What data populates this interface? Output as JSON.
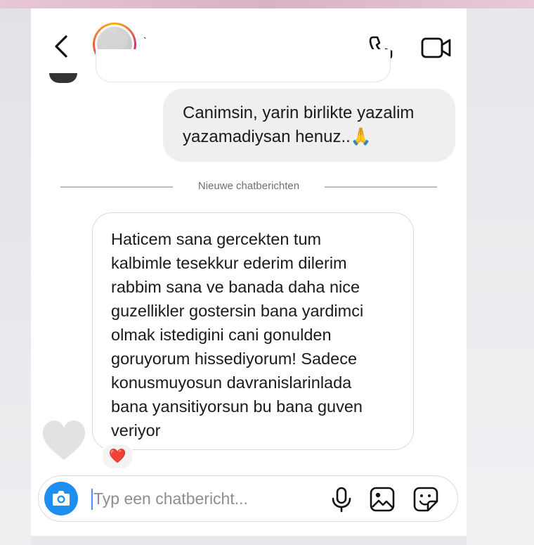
{
  "header": {
    "back_icon": "chevron-left-icon",
    "contact_name": "`",
    "call_icon": "phone-icon",
    "video_icon": "video-camera-icon"
  },
  "thread": {
    "outgoing": {
      "lines": [
        "Canimsin, yarin birlikte yazalim",
        "yazamadiysan henuz..🙏"
      ]
    },
    "divider_label": "Nieuwe chatberichten",
    "incoming": {
      "lines": [
        "Haticem sana gercekten tum",
        "kalbimle tesekkur ederim dilerim",
        "rabbim sana ve banada daha nice",
        "guzellikler gostersin bana yardimci",
        "olmak istedigini cani gonulden",
        "goruyorum hissediyorum! Sadece",
        "konusmuyosun davranislarinlada",
        "bana yansitiyorsun bu bana guven",
        "veriyor"
      ],
      "reaction": "❤️"
    }
  },
  "composer": {
    "placeholder": "Typ een chatbericht...",
    "value": "",
    "camera_icon": "camera-icon",
    "mic_icon": "microphone-icon",
    "gallery_icon": "image-icon",
    "sticker_icon": "sticker-icon"
  },
  "colors": {
    "accent": "#1f8ef1",
    "outgoing_bubble": "#efefef",
    "reaction_heart": "#e0245e"
  }
}
